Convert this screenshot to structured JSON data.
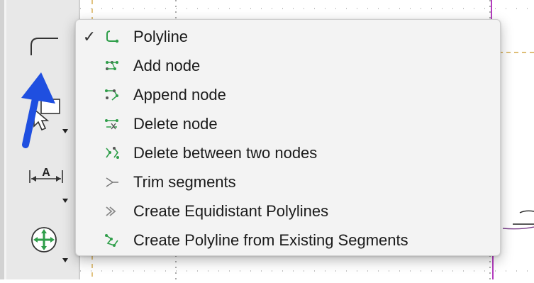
{
  "menu": {
    "items": [
      {
        "label": "Polyline",
        "checked": true,
        "icon": "polyline-icon"
      },
      {
        "label": "Add node",
        "checked": false,
        "icon": "add-node-icon"
      },
      {
        "label": "Append node",
        "checked": false,
        "icon": "append-node-icon"
      },
      {
        "label": "Delete node",
        "checked": false,
        "icon": "delete-node-icon"
      },
      {
        "label": "Delete between two nodes",
        "checked": false,
        "icon": "delete-between-nodes-icon"
      },
      {
        "label": "Trim segments",
        "checked": false,
        "icon": "trim-segments-icon"
      },
      {
        "label": "Create Equidistant Polylines",
        "checked": false,
        "icon": "equidistant-polylines-icon"
      },
      {
        "label": "Create Polyline from Existing Segments",
        "checked": false,
        "icon": "polyline-from-segments-icon"
      }
    ],
    "check_glyph": "✓"
  },
  "toolbar": {
    "tools": [
      "polyline-tool-icon",
      "select-tool-icon",
      "dimension-tool-icon",
      "modify-tool-icon"
    ],
    "dimension_letter": "A"
  },
  "colors": {
    "menu_bg": "#f3f3f3",
    "icon_green": "#2f9e4a",
    "arrow_blue": "#1f4fe0",
    "grid_gold": "#d4a94a",
    "guide_magenta": "#b43cbf"
  }
}
